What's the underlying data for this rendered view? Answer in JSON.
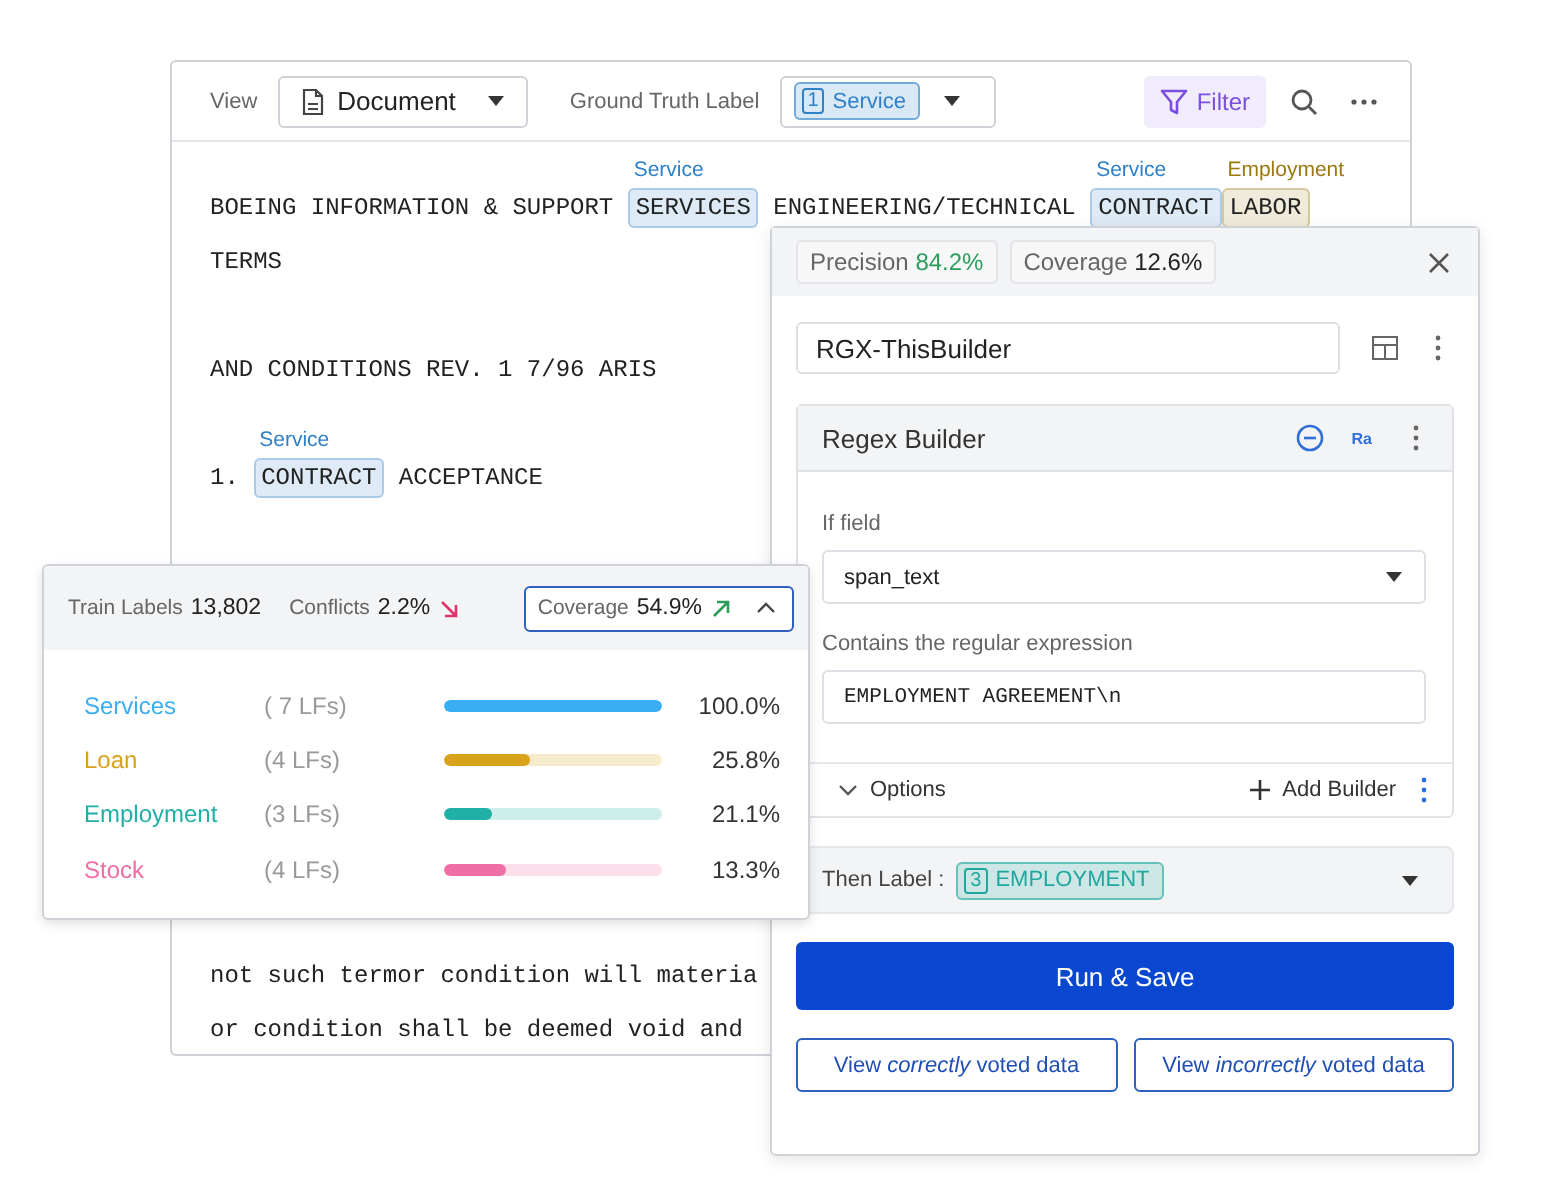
{
  "toolbar": {
    "view_label": "View",
    "view": "Document",
    "gt_label": "Ground Truth Label",
    "gt_chip": {
      "index": "1",
      "label": "Service",
      "color": "#2f80c8"
    },
    "filter": "Filter"
  },
  "document": {
    "paragraphs": [
      {
        "lines": [
          {
            "segments": [
              {
                "text": "BOEING INFORMATION & SUPPORT "
              },
              {
                "text": "SERVICES",
                "label": "Service",
                "color": "#2f80c8"
              },
              {
                "text": " ENGINEERING/TECHNICAL "
              },
              {
                "text": "CONTRACT",
                "label": "Service",
                "color": "#2f80c8"
              },
              {
                "text": "LABOR",
                "label": "Employment",
                "color": "#9a7a10"
              }
            ]
          },
          {
            "segments": [
              {
                "text": "TERMS"
              }
            ]
          }
        ]
      },
      {
        "lines": [
          {
            "segments": [
              {
                "text": "AND CONDITIONS REV. 1 7/96 ARIS"
              }
            ]
          }
        ]
      },
      {
        "lines": [
          {
            "segments": [
              {
                "text": "1. "
              },
              {
                "text": "CONTRACT",
                "label": "Service",
                "color": "#2f80c8"
              },
              {
                "text": " ACCEPTANCE"
              }
            ]
          }
        ]
      }
    ],
    "lower_lines": [
      "not such termor condition will materia",
      "or condition shall be deemed void and"
    ]
  },
  "coverage_popup": {
    "stats": [
      {
        "label": "Train Labels",
        "value": "13,802",
        "kind": "plain"
      },
      {
        "label": "Conflicts",
        "value": "2.2%",
        "kind": "down"
      },
      {
        "label": "Coverage",
        "value": "54.9%",
        "kind": "up",
        "expanded": true
      }
    ],
    "rows": [
      {
        "name": "Services",
        "lfs": "( 7 LFs)",
        "level": 1.0,
        "reading": "100.0%",
        "color": "#3aaef5"
      },
      {
        "name": "Loan",
        "lfs": "(4 LFs)",
        "level": 0.39,
        "reading": "25.8%",
        "color": "#d9a21b"
      },
      {
        "name": "Employment",
        "lfs": "(3 LFs)",
        "level": 0.22,
        "reading": "21.1%",
        "color": "#20b0a6"
      },
      {
        "name": "Stock",
        "lfs": "(4 LFs)",
        "level": 0.28,
        "reading": "13.3%",
        "color": "#f06ea6"
      }
    ]
  },
  "builder": {
    "metrics": [
      {
        "label": "Precision",
        "value": "84.2%",
        "kind": "good"
      },
      {
        "label": "Coverage",
        "value": "12.6%",
        "kind": "plain"
      }
    ],
    "name_value": "RGX-ThisBuilder",
    "card": {
      "title": "Regex Builder",
      "regex_badge": "Ra",
      "field_label": "If field",
      "field_value": "span_text",
      "expr_label": "Contains the regular expression",
      "expr_value": "EMPLOYMENT AGREEMENT\\n",
      "options": "Options",
      "options_expanded": false,
      "add": "Add Builder"
    },
    "then_label": "Then Label :",
    "then_chip": {
      "index": "3",
      "label": "EMPLOYMENT",
      "color": "#20a89e"
    },
    "run": "Run & Save",
    "views": [
      "View *correctly* voted data",
      "View *incorrectly* voted data"
    ]
  }
}
